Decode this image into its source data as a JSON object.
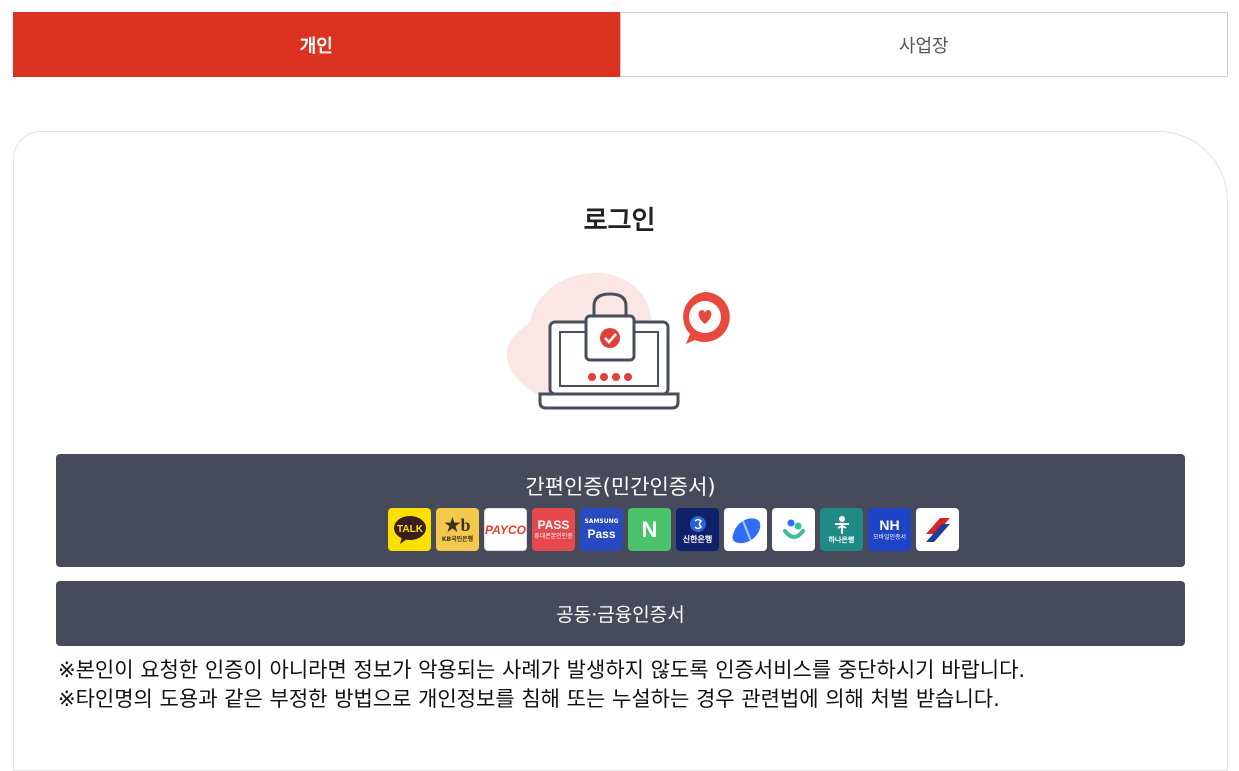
{
  "tabs": {
    "personal": "개인",
    "business": "사업장"
  },
  "login": {
    "title": "로그인"
  },
  "simple_auth": {
    "label": "간편인증(민간인증서)",
    "providers": [
      {
        "name": "kakaotalk-icon",
        "text": "TALK",
        "bg": "#f9e000",
        "fg": "#3a1d1d"
      },
      {
        "name": "kb-bank-icon",
        "text": "KB국민은행",
        "bg": "#f2c94c",
        "fg": "#5b4a2e"
      },
      {
        "name": "payco-icon",
        "text": "PAYCO",
        "bg": "#ffffff",
        "fg": "#e8402d"
      },
      {
        "name": "pass-icon",
        "text": "PASS",
        "sub": "휴대폰본인인증",
        "bg": "#e5484d",
        "fg": "#ffffff"
      },
      {
        "name": "samsung-pass-icon",
        "text": "Pass",
        "sub": "SAMSUNG",
        "bg": "#2a4bbf",
        "fg": "#ffffff"
      },
      {
        "name": "naver-icon",
        "text": "N",
        "bg": "#4cc26a",
        "fg": "#ffffff"
      },
      {
        "name": "shinhan-bank-icon",
        "text": "신한은행",
        "bg": "#10216b",
        "fg": "#ffffff"
      },
      {
        "name": "toss-icon",
        "text": "",
        "bg": "#ffffff",
        "fg": "#2f6df6"
      },
      {
        "name": "banksalad-icon",
        "text": "",
        "bg": "#ffffff",
        "fg": "#3bbf9a"
      },
      {
        "name": "hana-bank-icon",
        "text": "하나은행",
        "bg": "#1f8a86",
        "fg": "#ffffff"
      },
      {
        "name": "nh-icon",
        "text": "NH",
        "sub": "모바일인증서",
        "bg": "#1d43c6",
        "fg": "#ffffff"
      },
      {
        "name": "kftc-icon",
        "text": "",
        "bg": "#ffffff",
        "fg": "#d8262d"
      }
    ]
  },
  "cert_auth": {
    "label": "공동·금융인증서"
  },
  "notice": {
    "line1": "※본인이 요청한 인증이 아니라면 정보가 악용되는 사례가 발생하지 않도록 인증서비스를 중단하시기 바랍니다.",
    "line2": "※타인명의 도용과 같은 부정한 방법으로 개인정보를 침해 또는 누설하는 경우 관련법에 의해 처벌 받습니다."
  }
}
